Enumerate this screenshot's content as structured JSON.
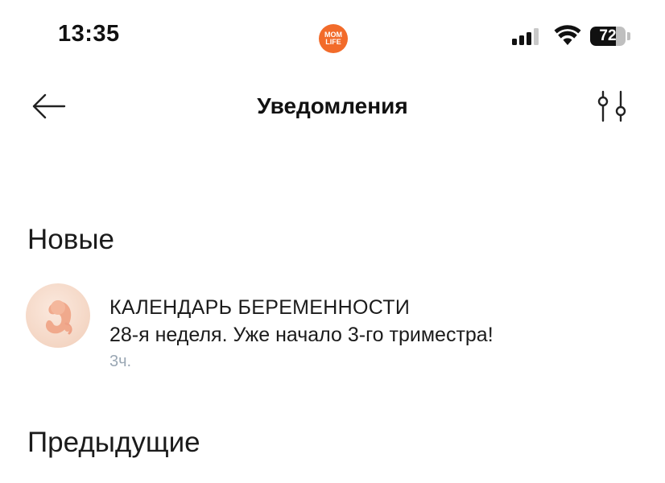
{
  "status_bar": {
    "time": "13:35",
    "app_logo_line1": "MOM",
    "app_logo_line2": "LIFE",
    "battery_level": "72",
    "signal_bars_active": 3,
    "signal_bars_total": 4
  },
  "nav": {
    "title": "Уведомления",
    "back_icon": "arrow-left-icon",
    "filter_icon": "sliders-icon"
  },
  "sections": {
    "new_title": "Новые",
    "previous_title": "Предыдущие"
  },
  "notifications": [
    {
      "source": "КАЛЕНДАРЬ БЕРЕМЕННОСТИ",
      "text": "28-я неделя. Уже начало 3-го триместра!",
      "time": "3ч.",
      "icon": "embryo-icon"
    }
  ],
  "colors": {
    "brand": "#f26b2a",
    "time_text": "#9aa7b4"
  }
}
